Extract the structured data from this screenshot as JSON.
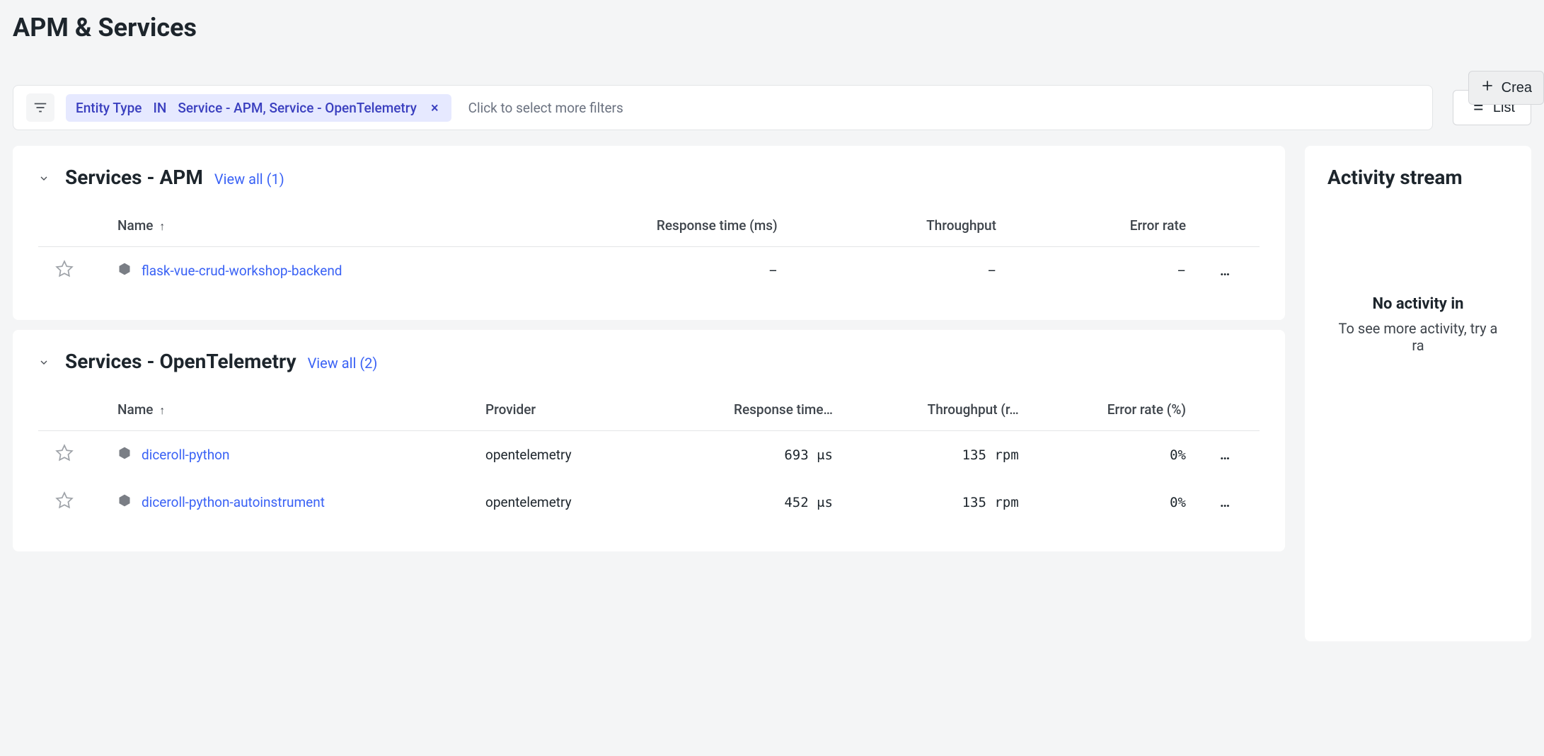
{
  "header": {
    "title": "APM & Services",
    "create_label": "Crea"
  },
  "filter": {
    "chip": {
      "key": "Entity Type",
      "op": "IN",
      "value": "Service - APM, Service - OpenTelemetry"
    },
    "placeholder": "Click to select more filters",
    "list_label": "List"
  },
  "sections": [
    {
      "id": "apm",
      "title": "Services - APM",
      "view_all": "View all (1)",
      "columns": [
        {
          "key": "name",
          "label": "Name",
          "sort": "↑",
          "align": "left"
        },
        {
          "key": "rt",
          "label": "Response time (ms)",
          "align": "right"
        },
        {
          "key": "tp",
          "label": "Throughput",
          "align": "right"
        },
        {
          "key": "er",
          "label": "Error rate",
          "align": "right"
        }
      ],
      "rows": [
        {
          "name": "flask-vue-crud-workshop-backend",
          "rt": "–",
          "tp": "–",
          "er": "–"
        }
      ]
    },
    {
      "id": "otel",
      "title": "Services - OpenTelemetry",
      "view_all": "View all (2)",
      "columns": [
        {
          "key": "name",
          "label": "Name",
          "sort": "↑",
          "align": "left"
        },
        {
          "key": "provider",
          "label": "Provider",
          "align": "left"
        },
        {
          "key": "rt",
          "label": "Response time…",
          "align": "right"
        },
        {
          "key": "tp",
          "label": "Throughput (r…",
          "align": "right"
        },
        {
          "key": "er",
          "label": "Error rate (%)",
          "align": "right"
        }
      ],
      "rows": [
        {
          "name": "diceroll-python",
          "provider": "opentelemetry",
          "rt": "693 μs",
          "tp": "135 rpm",
          "er": "0%"
        },
        {
          "name": "diceroll-python-autoinstrument",
          "provider": "opentelemetry",
          "rt": "452 μs",
          "tp": "135 rpm",
          "er": "0%"
        }
      ]
    }
  ],
  "sidebar": {
    "title": "Activity stream",
    "no_activity": "No activity in",
    "hint_line1": "To see more activity, try a",
    "hint_line2": "ra"
  }
}
